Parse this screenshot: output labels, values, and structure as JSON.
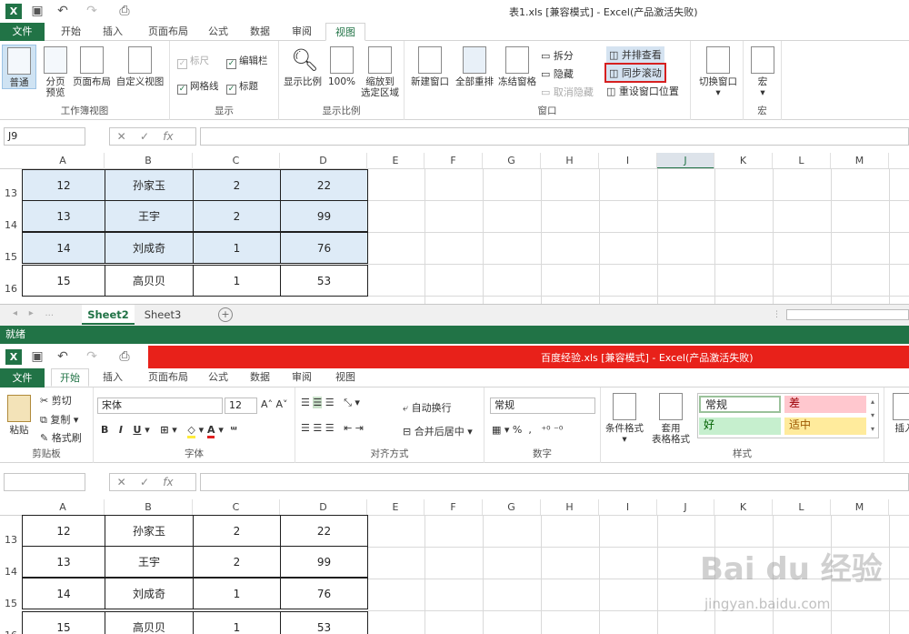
{
  "win1": {
    "title": "表1.xls  [兼容模式] - Excel(产品激活失败)",
    "tabs": [
      "文件",
      "开始",
      "插入",
      "页面布局",
      "公式",
      "数据",
      "审阅",
      "视图"
    ],
    "groups": {
      "workbook_views": "工作簿视图",
      "show": "显示",
      "zoom": "显示比例",
      "window": "窗口",
      "macros": "宏"
    },
    "buttons": {
      "normal": "普通",
      "page_break": "分页\n预览",
      "page_layout": "页面布局",
      "custom_view": "自定义视图",
      "zoom": "显示比例",
      "zoom100": "100%",
      "zoom_sel": "缩放到\n选定区域",
      "new_win": "新建窗口",
      "arrange": "全部重排",
      "freeze": "冻结窗格",
      "split": "拆分",
      "hide": "隐藏",
      "unhide": "取消隐藏",
      "side_by_side": "并排查看",
      "sync_scroll": "同步滚动",
      "reset_pos": "重设窗口位置",
      "switch": "切换窗口",
      "macros": "宏"
    },
    "checks": {
      "ruler": "标尺",
      "formula_bar": "编辑栏",
      "gridlines": "网格线",
      "headings": "标题"
    },
    "namebox": "J9",
    "sheets": [
      "Sheet2",
      "Sheet3"
    ],
    "status": "就绪"
  },
  "win2": {
    "title": "百度经验.xls  [兼容模式] - Excel(产品激活失败)",
    "tabs": [
      "文件",
      "开始",
      "插入",
      "页面布局",
      "公式",
      "数据",
      "审阅",
      "视图"
    ],
    "groups": {
      "clipboard": "剪贴板",
      "font": "字体",
      "align": "对齐方式",
      "number": "数字",
      "styles": "样式"
    },
    "buttons": {
      "paste": "粘贴",
      "cut": "剪切",
      "copy": "复制",
      "painter": "格式刷",
      "wrap": "自动换行",
      "merge": "合并后居中",
      "cond": "条件格式",
      "table": "套用\n表格格式",
      "insert": "插入"
    },
    "font": {
      "name": "宋体",
      "size": "12"
    },
    "number_format": "常规",
    "styles": {
      "normal": "常规",
      "bad": "差",
      "good": "好",
      "neutral": "适中"
    }
  },
  "grid": {
    "cols": [
      "A",
      "B",
      "C",
      "D",
      "E",
      "F",
      "G",
      "H",
      "I",
      "J",
      "K",
      "L",
      "M"
    ],
    "rows": [
      {
        "n": "13",
        "a": "12",
        "b": "孙家玉",
        "c": "2",
        "d": "22"
      },
      {
        "n": "14",
        "a": "13",
        "b": "王宇",
        "c": "2",
        "d": "99"
      },
      {
        "n": "15",
        "a": "14",
        "b": "刘成奇",
        "c": "1",
        "d": "76"
      },
      {
        "n": "16",
        "a": "15",
        "b": "高贝贝",
        "c": "1",
        "d": "53"
      }
    ]
  },
  "watermark": {
    "logo": "Bai du 经验",
    "url": "jingyan.baidu.com"
  }
}
